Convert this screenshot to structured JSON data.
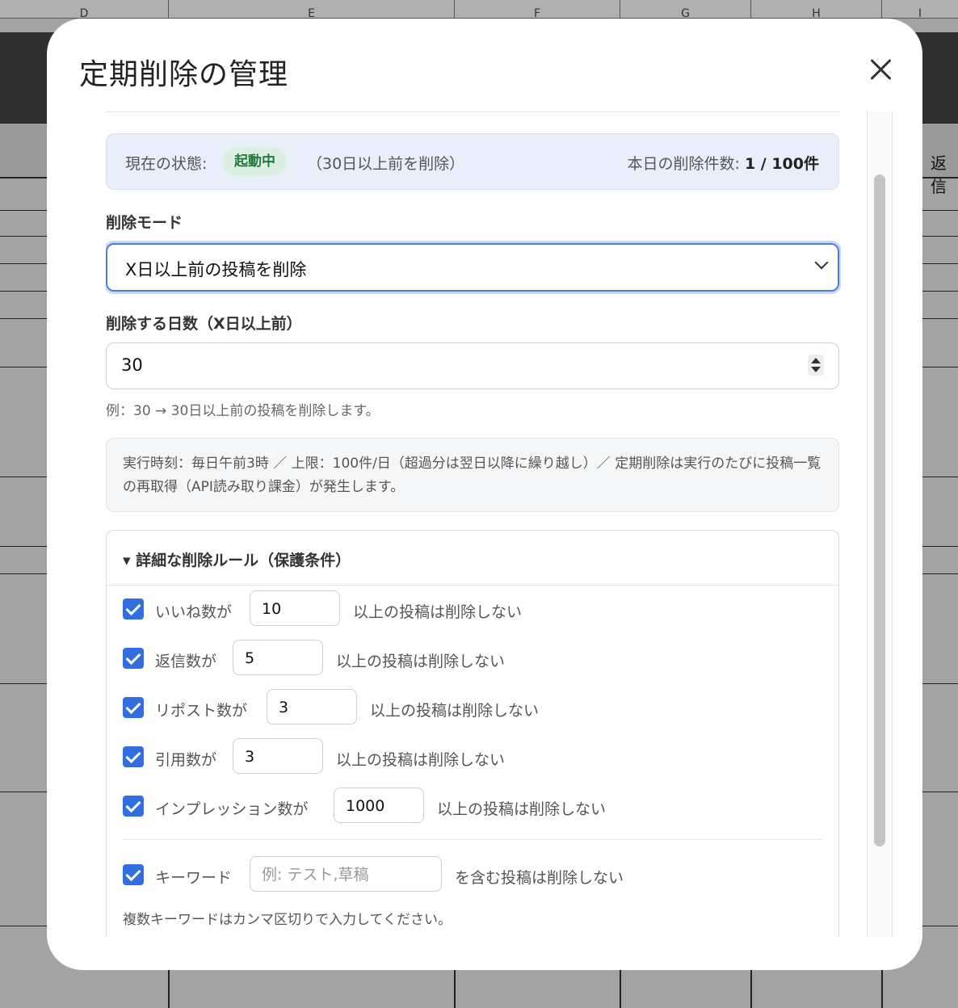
{
  "spreadsheet": {
    "column_headers": [
      "D",
      "E",
      "F",
      "G",
      "H",
      "I"
    ],
    "right_cell_text": "返信"
  },
  "modal": {
    "title": "定期削除の管理",
    "close_icon": "close-icon",
    "status": {
      "label": "現在の状態:",
      "badge": "起動中",
      "note": "（30日以上前を削除）",
      "count_label": "本日の削除件数:",
      "count_value": "1 / 100件"
    },
    "mode": {
      "label": "削除モード",
      "selected": "X日以上前の投稿を削除"
    },
    "days": {
      "label": "削除する日数（X日以上前）",
      "value": "30",
      "hint": "例：30 → 30日以上前の投稿を削除します。"
    },
    "info": "実行時刻：毎日午前3時 ／ 上限：100件/日（超過分は翌日以降に繰り越し）／ 定期削除は実行のたびに投稿一覧の再取得（API読み取り課金）が発生します。",
    "details": {
      "summary": "▾ 詳細な削除ルール（保護条件）",
      "rules": [
        {
          "label": "いいね数が",
          "value": "10",
          "suffix": "以上の投稿は削除しない",
          "checked": true
        },
        {
          "label": "返信数が",
          "value": "5",
          "suffix": "以上の投稿は削除しない",
          "checked": true
        },
        {
          "label": "リポスト数が",
          "value": "3",
          "suffix": "以上の投稿は削除しない",
          "checked": true
        },
        {
          "label": "引用数が",
          "value": "3",
          "suffix": "以上の投稿は削除しない",
          "checked": true
        },
        {
          "label": "インプレッション数が",
          "value": "1000",
          "suffix": "以上の投稿は削除しない",
          "checked": true
        }
      ],
      "keyword": {
        "label": "キーワード",
        "placeholder": "例: テスト,草稿",
        "suffix": "を含む投稿は削除しない",
        "checked": true,
        "hint": "複数キーワードはカンマ区切りで入力してください。"
      }
    }
  }
}
